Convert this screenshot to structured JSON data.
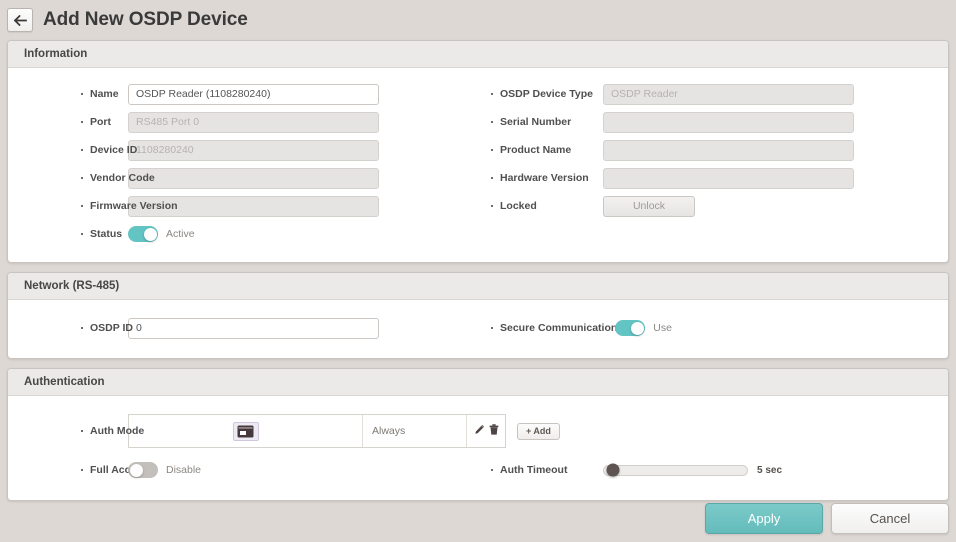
{
  "header": {
    "title": "Add New OSDP Device",
    "back_icon": "arrow-left-icon"
  },
  "sections": {
    "information": {
      "title": "Information",
      "left_fields": [
        {
          "label": "Name",
          "value": "OSDP Reader (1108280240)",
          "placeholder": "",
          "readonly": false
        },
        {
          "label": "Port",
          "value": "",
          "placeholder": "RS485 Port 0",
          "readonly": true
        },
        {
          "label": "Device ID",
          "value": "",
          "placeholder": "1108280240",
          "readonly": true
        },
        {
          "label": "Vendor Code",
          "value": "",
          "placeholder": "",
          "readonly": true
        },
        {
          "label": "Firmware Version",
          "value": "",
          "placeholder": "",
          "readonly": true
        }
      ],
      "status": {
        "label": "Status",
        "state": "on",
        "text": "Active"
      },
      "right_fields": [
        {
          "label": "OSDP Device Type",
          "value": "",
          "placeholder": "OSDP Reader",
          "readonly": true
        },
        {
          "label": "Serial Number",
          "value": "",
          "placeholder": "",
          "readonly": true
        },
        {
          "label": "Product Name",
          "value": "",
          "placeholder": "",
          "readonly": true
        },
        {
          "label": "Hardware Version",
          "value": "",
          "placeholder": "",
          "readonly": true
        }
      ],
      "locked": {
        "label": "Locked",
        "button_label": "Unlock"
      }
    },
    "network": {
      "title": "Network (RS-485)",
      "osdp_id": {
        "label": "OSDP ID",
        "value": "0"
      },
      "secure_communication": {
        "label": "Secure Communication",
        "state": "on",
        "text": "Use"
      }
    },
    "authentication": {
      "title": "Authentication",
      "auth_mode": {
        "label": "Auth Mode",
        "rows": [
          {
            "icon": "card-icon",
            "condition": "Always",
            "edit_icon": "pencil-icon",
            "delete_icon": "trash-icon"
          }
        ],
        "add_label": "+ Add"
      },
      "full_access": {
        "label": "Full Access",
        "state": "off",
        "text": "Disable"
      },
      "auth_timeout": {
        "label": "Auth Timeout",
        "value": "5 sec",
        "slider_percent": 5
      }
    }
  },
  "footer": {
    "apply_label": "Apply",
    "cancel_label": "Cancel"
  },
  "colors": {
    "accent": "#62c4c3",
    "page_bg": "#ddd8d3",
    "panel_header": "#eceae8"
  }
}
